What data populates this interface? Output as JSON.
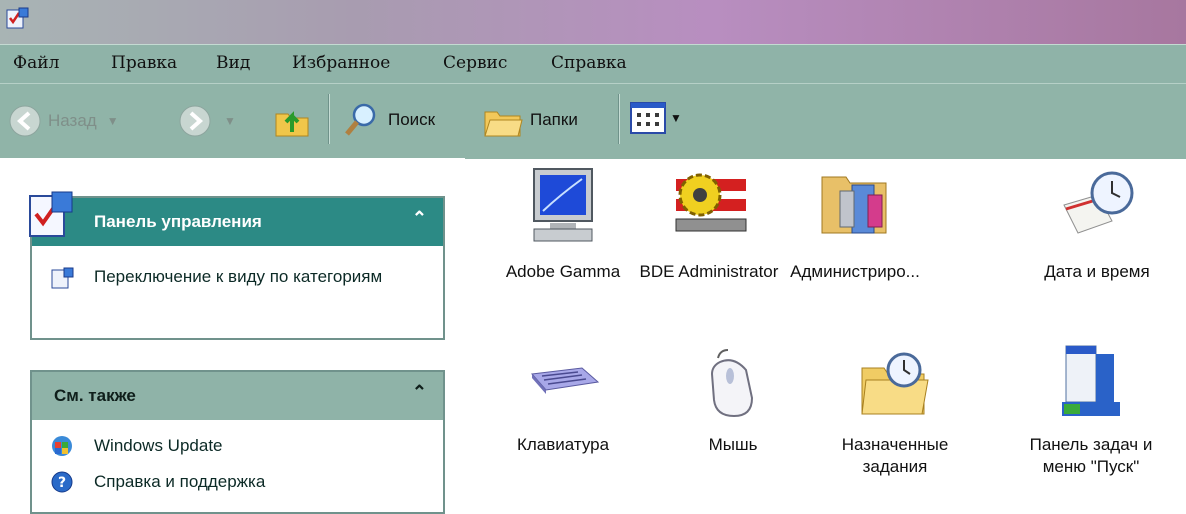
{
  "menu": [
    "Файл",
    "Правка",
    "Вид",
    "Избранное",
    "Сервис",
    "Справка"
  ],
  "toolbar": {
    "back": "Назад",
    "search": "Поиск",
    "folders": "Папки"
  },
  "taskpane": {
    "control_panel": {
      "title": "Панель управления",
      "links": [
        "Переключение к виду по категориям"
      ]
    },
    "see_also": {
      "title": "См. также",
      "links": [
        "Windows Update",
        "Справка и поддержка"
      ]
    }
  },
  "items": [
    {
      "label": "Adobe Gamma",
      "icon": "monitor-icon"
    },
    {
      "label": "BDE Administrator",
      "icon": "bde-gear-icon"
    },
    {
      "label": "Администриро...",
      "icon": "admin-tools-icon"
    },
    {
      "label": "Дата и время",
      "icon": "clock-calendar-icon"
    },
    {
      "label": "Клавиатура",
      "icon": "keyboard-icon"
    },
    {
      "label": "Мышь",
      "icon": "mouse-icon"
    },
    {
      "label": "Назначенные\nзадания",
      "icon": "scheduled-tasks-icon"
    },
    {
      "label": "Панель задач и\nменю \"Пуск\"",
      "icon": "taskbar-icon"
    }
  ]
}
